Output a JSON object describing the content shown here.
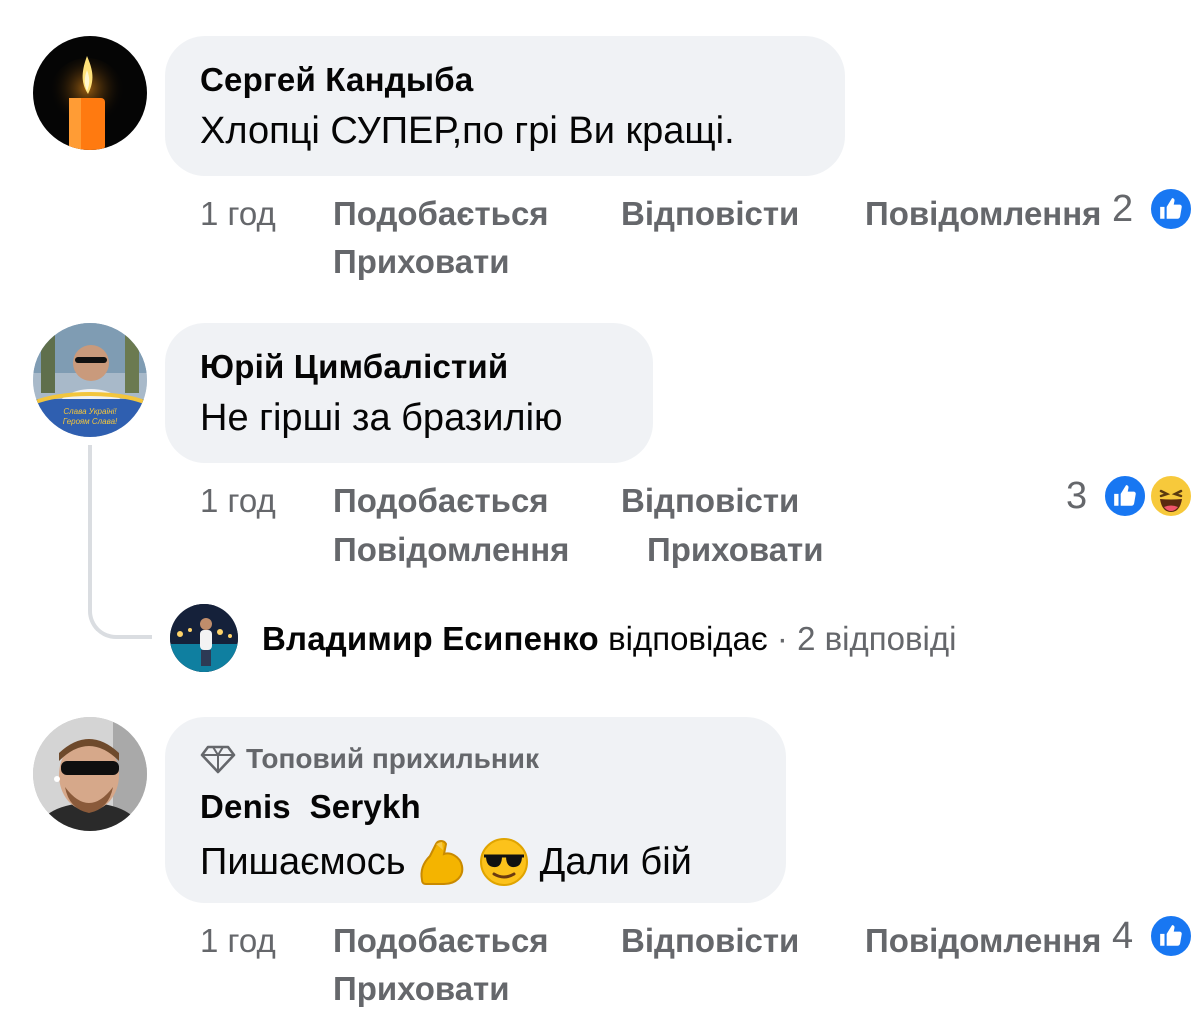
{
  "comments": [
    {
      "author": "Сергей Кандыба",
      "text": "Хлопці СУПЕР,по грі Ви кращі.",
      "time": "1 год",
      "like": "Подобається",
      "reply": "Відповісти",
      "report": "Повідомлення",
      "hide": "Приховати",
      "reaction_count": "2",
      "reactions": [
        "like-icon"
      ]
    },
    {
      "author": "Юрій Цимбалістий",
      "text": "Не гірші за бразилію",
      "time": "1 год",
      "like": "Подобається",
      "reply": "Відповісти",
      "report": "Повідомлення",
      "hide": "Приховати",
      "reaction_count": "3",
      "reactions": [
        "like-icon",
        "haha-icon"
      ],
      "avatar_caption_1": "Слава Україні!",
      "avatar_caption_2": "Героям Слава!",
      "reply_preview": {
        "author": "Владимир Есипенко",
        "verb": "відповідає",
        "separator": "·",
        "count": "2 відповіді"
      }
    },
    {
      "badge": "Топовий прихильник",
      "author": "Denis  Serykh",
      "text_before": "Пишаємось",
      "text_after": "Дали бій",
      "time": "1 год",
      "like": "Подобається",
      "reply": "Відповісти",
      "report": "Повідомлення",
      "hide": "Приховати",
      "reaction_count": "4",
      "reactions": [
        "like-icon"
      ]
    }
  ],
  "colors": {
    "bubble": "#f0f2f5",
    "meta": "#65676b",
    "like_blue": "#1877f2",
    "thread_line": "#dadde1"
  }
}
